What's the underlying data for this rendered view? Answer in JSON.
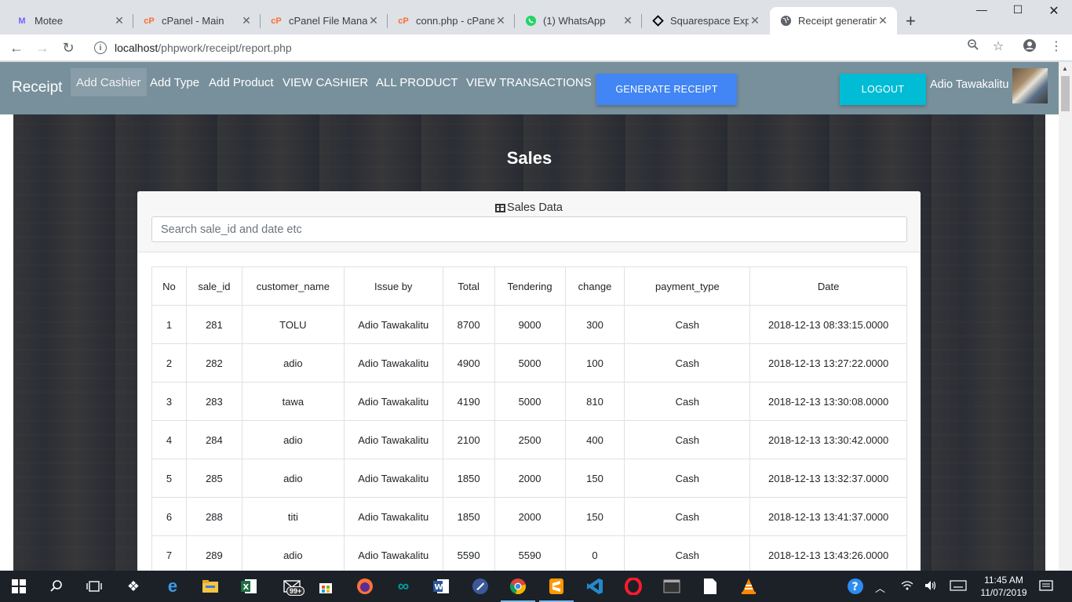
{
  "browser": {
    "tabs": [
      {
        "title": "Motee",
        "icon": "motee-icon",
        "color": "#7b5cff"
      },
      {
        "title": "cPanel - Main",
        "icon": "cpanel-icon",
        "color": "#ff6c2c"
      },
      {
        "title": "cPanel File Manag",
        "icon": "cpanel-icon",
        "color": "#ff6c2c"
      },
      {
        "title": "conn.php - cPanel",
        "icon": "cpanel-icon",
        "color": "#ff6c2c"
      },
      {
        "title": "(1) WhatsApp",
        "icon": "whatsapp-icon",
        "color": "#25d366"
      },
      {
        "title": "Squarespace Expe",
        "icon": "squarespace-icon",
        "color": "#000000"
      },
      {
        "title": "Receipt generating",
        "icon": "globe-icon",
        "color": "#5f6368"
      }
    ],
    "address": {
      "host": "localhost",
      "path": "/phpwork/receipt/report.php"
    }
  },
  "navbar": {
    "brand": "Receipt",
    "links": [
      "Add Cashier",
      "Add Type",
      "Add Product",
      "VIEW CASHIER",
      "ALL PRODUCT",
      "VIEW TRANSACTIONS"
    ],
    "active_link": "Add Cashier",
    "generate_label": "GENERATE RECEIPT",
    "logout_label": "LOGOUT",
    "user_name": "Adio Tawakalitu",
    "colors": {
      "bar": "#78909c",
      "generate": "#4285f4",
      "logout": "#00bcd4"
    }
  },
  "page": {
    "heading": "Sales",
    "card_title": "Sales Data",
    "search_placeholder": "Search sale_id and date etc"
  },
  "table": {
    "columns": [
      "No",
      "sale_id",
      "customer_name",
      "Issue by",
      "Total",
      "Tendering",
      "change",
      "payment_type",
      "Date"
    ],
    "rows": [
      [
        "1",
        "281",
        "TOLU",
        "Adio Tawakalitu",
        "8700",
        "9000",
        "300",
        "Cash",
        "2018-12-13 08:33:15.0000"
      ],
      [
        "2",
        "282",
        "adio",
        "Adio Tawakalitu",
        "4900",
        "5000",
        "100",
        "Cash",
        "2018-12-13 13:27:22.0000"
      ],
      [
        "3",
        "283",
        "tawa",
        "Adio Tawakalitu",
        "4190",
        "5000",
        "810",
        "Cash",
        "2018-12-13 13:30:08.0000"
      ],
      [
        "4",
        "284",
        "adio",
        "Adio Tawakalitu",
        "2100",
        "2500",
        "400",
        "Cash",
        "2018-12-13 13:30:42.0000"
      ],
      [
        "5",
        "285",
        "adio",
        "Adio Tawakalitu",
        "1850",
        "2000",
        "150",
        "Cash",
        "2018-12-13 13:32:37.0000"
      ],
      [
        "6",
        "288",
        "titi",
        "Adio Tawakalitu",
        "1850",
        "2000",
        "150",
        "Cash",
        "2018-12-13 13:41:37.0000"
      ],
      [
        "7",
        "289",
        "adio",
        "Adio Tawakalitu",
        "5590",
        "5590",
        "0",
        "Cash",
        "2018-12-13 13:43:26.0000"
      ]
    ]
  },
  "taskbar": {
    "clock_time": "11:45 AM",
    "clock_date": "11/07/2019",
    "mail_badge": "99+"
  }
}
